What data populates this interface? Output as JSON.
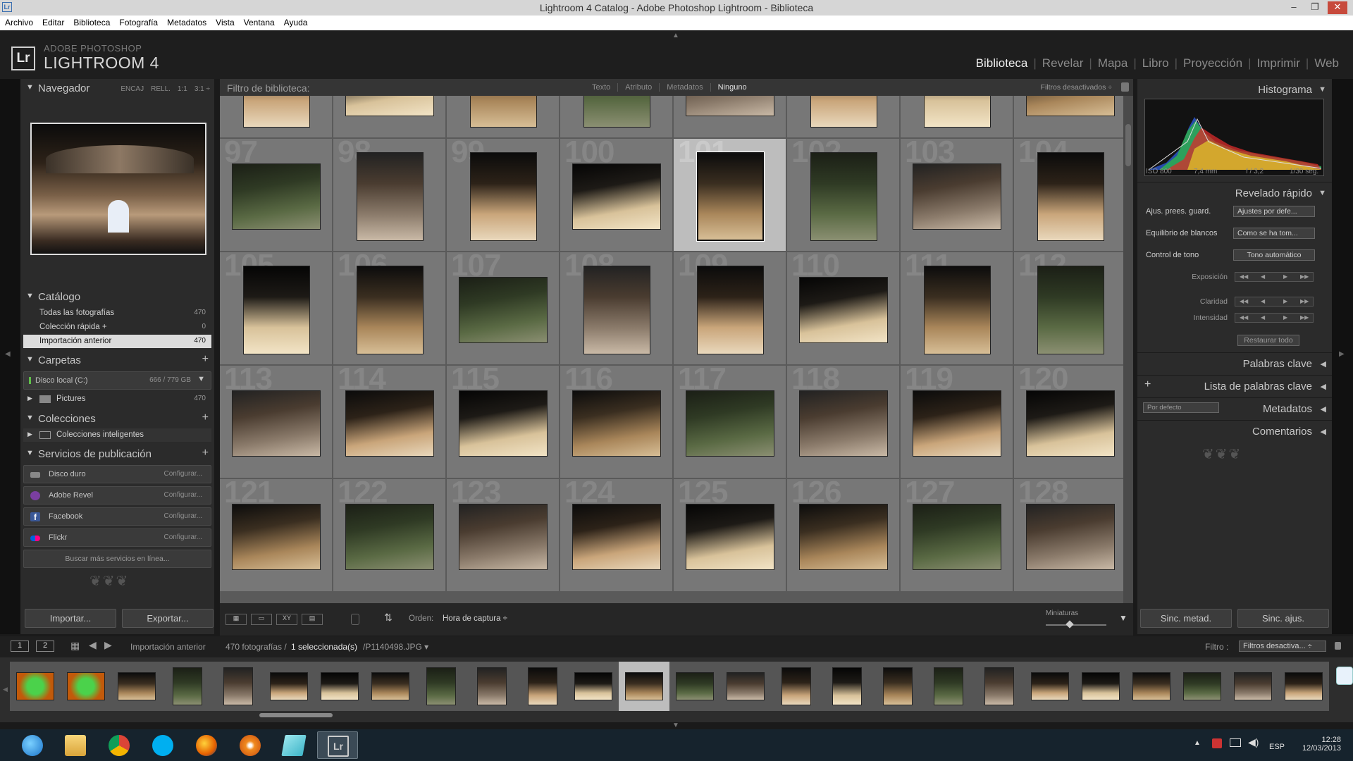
{
  "window": {
    "title": "Lightroom 4 Catalog - Adobe Photoshop Lightroom - Biblioteca",
    "lr_icon": "Lr"
  },
  "menu": [
    "Archivo",
    "Editar",
    "Biblioteca",
    "Fotografía",
    "Metadatos",
    "Vista",
    "Ventana",
    "Ayuda"
  ],
  "brand": {
    "logo": "Lr",
    "line1": "ADOBE PHOTOSHOP",
    "line2": "LIGHTROOM 4"
  },
  "modules": [
    {
      "label": "Biblioteca",
      "active": true
    },
    {
      "label": "Revelar"
    },
    {
      "label": "Mapa"
    },
    {
      "label": "Libro"
    },
    {
      "label": "Proyección"
    },
    {
      "label": "Imprimir"
    },
    {
      "label": "Web"
    }
  ],
  "navigator": {
    "title": "Navegador",
    "options": [
      "ENCAJ",
      "RELL.",
      "1:1",
      "3:1"
    ]
  },
  "catalog": {
    "title": "Catálogo",
    "items": [
      {
        "label": "Todas las fotografías",
        "count": "470"
      },
      {
        "label": "Colección rápida +",
        "count": "0"
      },
      {
        "label": "Importación anterior",
        "count": "470",
        "selected": true
      }
    ]
  },
  "folders": {
    "title": "Carpetas",
    "disk": {
      "label": "Disco local (C:)",
      "size": "666 / 779 GB"
    },
    "items": [
      {
        "label": "Pictures",
        "count": "470"
      }
    ]
  },
  "collections": {
    "title": "Colecciones",
    "items": [
      {
        "label": "Colecciones inteligentes"
      }
    ]
  },
  "publish": {
    "title": "Servicios de publicación",
    "services": [
      {
        "label": "Disco duro",
        "action": "Configurar...",
        "color": "#888888"
      },
      {
        "label": "Adobe Revel",
        "action": "Configurar...",
        "color": "#7a3fa0"
      },
      {
        "label": "Facebook",
        "action": "Configurar...",
        "color": "#3b5998"
      },
      {
        "label": "Flickr",
        "action": "Configurar...",
        "color": "#ff0084"
      }
    ],
    "more": "Buscar más servicios en línea..."
  },
  "left_buttons": {
    "import": "Importar...",
    "export": "Exportar..."
  },
  "filter": {
    "label": "Filtro de biblioteca:",
    "options": [
      {
        "label": "Texto"
      },
      {
        "label": "Atributo"
      },
      {
        "label": "Metadatos"
      },
      {
        "label": "Ninguno",
        "active": true
      }
    ],
    "status": "Filtros desactivados ÷"
  },
  "grid": {
    "first_number": 97,
    "rows": 5,
    "cols": 8,
    "selected_number": 101
  },
  "toolbar": {
    "order_label": "Orden:",
    "order_value": "Hora de captura ÷",
    "thumbs_label": "Miniaturas"
  },
  "histogram": {
    "title": "Histograma",
    "iso": "ISO 800",
    "focal": "7,4 mm",
    "aperture": "f / 3,2",
    "shutter": "1/30 seg."
  },
  "quick_develop": {
    "title": "Revelado rápido",
    "preset_label": "Ajus. prees. guard.",
    "preset_value": "Ajustes por defe...",
    "wb_label": "Equilibrio de blancos",
    "wb_value": "Como se ha tom...",
    "tone_label": "Control de tono",
    "tone_btn": "Tono automático",
    "exposure": "Exposición",
    "clarity": "Claridad",
    "vibrance": "Intensidad",
    "reset": "Restaurar todo"
  },
  "right_sections": [
    "Palabras clave",
    "Lista de palabras clave",
    "Metadatos",
    "Comentarios"
  ],
  "metadata_preset": "Por defecto",
  "right_buttons": {
    "sync_meta": "Sinc. metad.",
    "sync_settings": "Sinc. ajus."
  },
  "filmstrip": {
    "screen1": "1",
    "screen2": "2",
    "source": "Importación anterior",
    "count": "470 fotografías /",
    "selected": "1 seleccionada(s)",
    "file": "/P1140498.JPG ▾",
    "filter_label": "Filtro :",
    "filter_value": "Filtros desactiva... ÷"
  },
  "taskbar": {
    "lang": "ESP",
    "time": "12:28",
    "date": "12/03/2013"
  }
}
